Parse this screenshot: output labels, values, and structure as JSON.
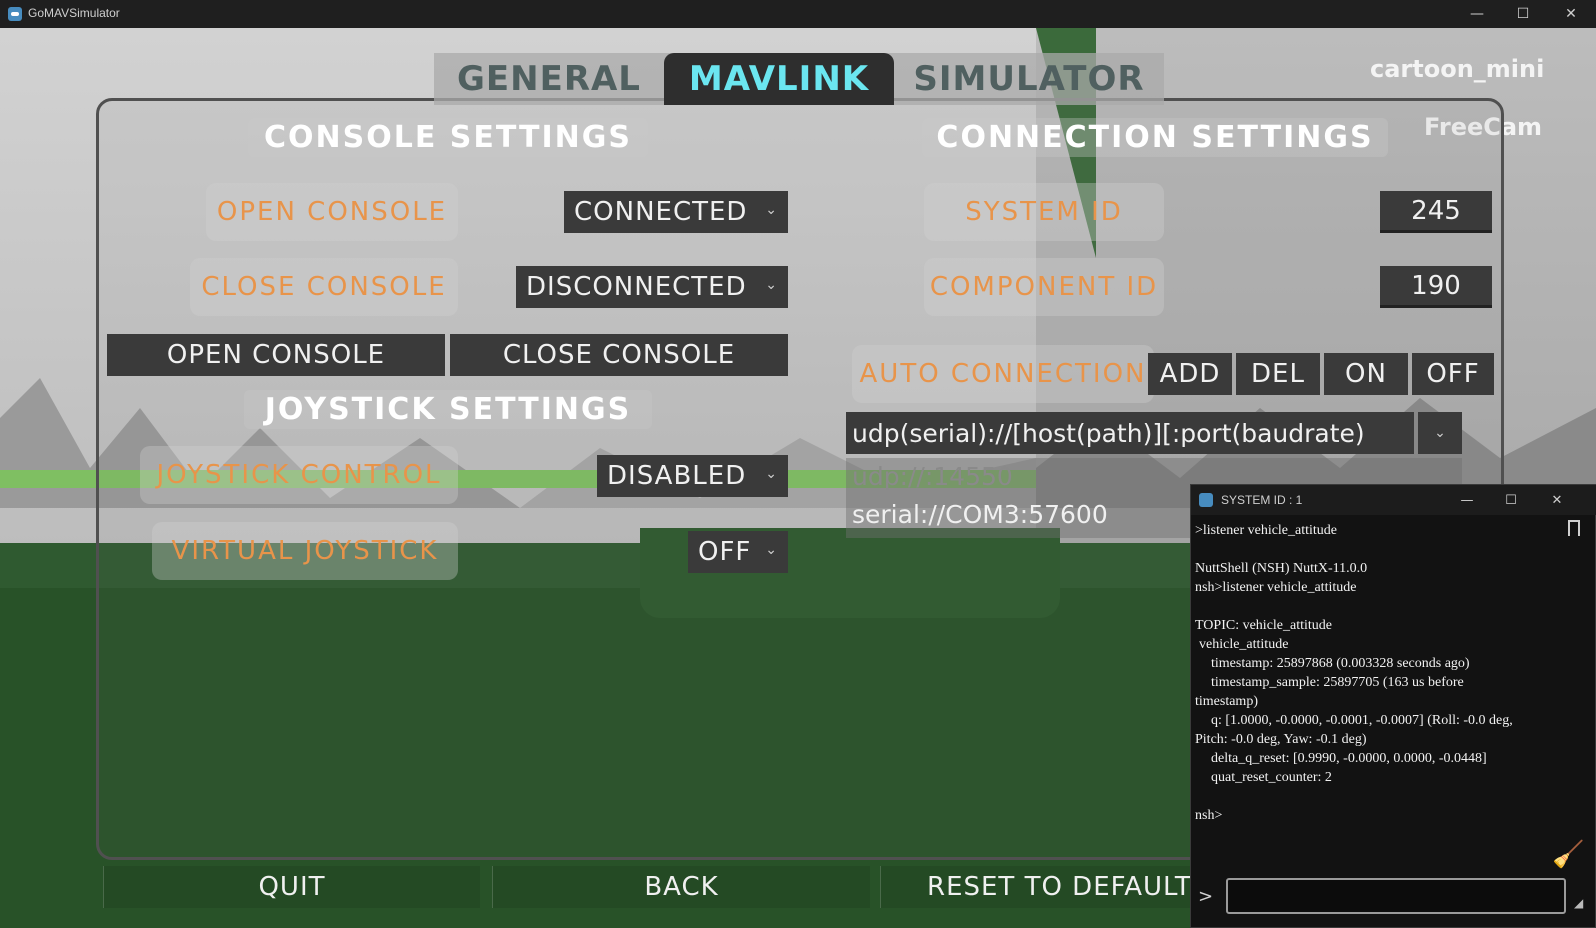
{
  "window": {
    "title": "GoMAVSimulator",
    "minimize": "—",
    "maximize": "☐",
    "close": "✕"
  },
  "tabs": [
    {
      "label": "GENERAL",
      "active": false
    },
    {
      "label": "MAVLINK",
      "active": true
    },
    {
      "label": "SIMULATOR",
      "active": false
    }
  ],
  "overlay": {
    "map_name": "cartoon_mini",
    "camera_mode": "FreeCam"
  },
  "console_settings": {
    "title": "CONSOLE SETTINGS",
    "open_console_label": "OPEN CONSOLE",
    "open_console_value": "CONNECTED",
    "close_console_label": "CLOSE CONSOLE",
    "close_console_value": "DISCONNECTED",
    "open_console_button": "OPEN CONSOLE",
    "close_console_button": "CLOSE CONSOLE"
  },
  "joystick_settings": {
    "title": "JOYSTICK SETTINGS",
    "joystick_control_label": "JOYSTICK CONTROL",
    "joystick_control_value": "DISABLED",
    "virtual_joystick_label": "VIRTUAL JOYSTICK",
    "virtual_joystick_value": "OFF"
  },
  "connection_settings": {
    "title": "CONNECTION SETTINGS",
    "system_id_label": "SYSTEM ID",
    "system_id_value": "245",
    "component_id_label": "COMPONENT ID",
    "component_id_value": "190",
    "auto_connection_label": "AUTO CONNECTION",
    "buttons": [
      "ADD",
      "DEL",
      "ON",
      "OFF"
    ],
    "url_value": "udp(serial)://[host(path)][:port(baudrate)",
    "connections": [
      "udp://:14550",
      "serial://COM3:57600"
    ]
  },
  "bottom_buttons": {
    "quit": "QUIT",
    "back": "BACK",
    "reset": "RESET TO DEFAULT"
  },
  "console": {
    "title": "SYSTEM ID : 1",
    "minimize": "—",
    "maximize": "☐",
    "close": "✕",
    "lines": [
      ">listener vehicle_attitude",
      "",
      "NuttShell (NSH) NuttX-11.0.0",
      "nsh>listener vehicle_attitude",
      "",
      "TOPIC: vehicle_attitude",
      " vehicle_attitude",
      "    timestamp: 25897868 (0.003328 seconds ago)",
      "    timestamp_sample: 25897705 (163 us before",
      "timestamp)",
      "    q: [1.0000, -0.0000, -0.0001, -0.0007] (Roll: -0.0 deg,",
      "Pitch: -0.0 deg, Yaw: -0.1 deg)",
      "    delta_q_reset: [0.9990, -0.0000, 0.0000, -0.0448]",
      "    quat_reset_counter: 2",
      "",
      "nsh>"
    ],
    "prompt": ">",
    "input_value": ""
  },
  "colors": {
    "label_orange": "#e8944a",
    "tab_active": "#6be6f0",
    "control_bg": "#3a3a3a"
  }
}
